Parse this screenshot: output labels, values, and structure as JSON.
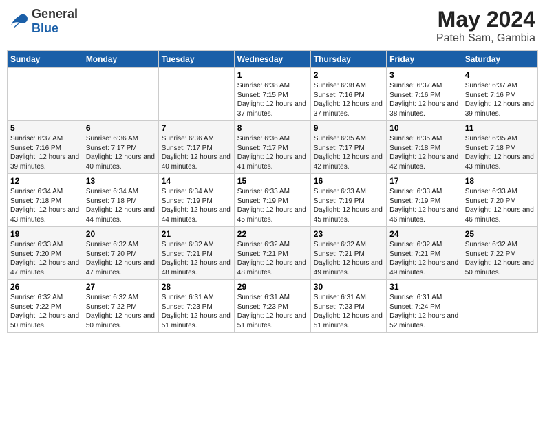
{
  "header": {
    "logo_general": "General",
    "logo_blue": "Blue",
    "month_year": "May 2024",
    "location": "Pateh Sam, Gambia"
  },
  "days_of_week": [
    "Sunday",
    "Monday",
    "Tuesday",
    "Wednesday",
    "Thursday",
    "Friday",
    "Saturday"
  ],
  "weeks": [
    [
      {
        "day": "",
        "sunrise": "",
        "sunset": "",
        "daylight": ""
      },
      {
        "day": "",
        "sunrise": "",
        "sunset": "",
        "daylight": ""
      },
      {
        "day": "",
        "sunrise": "",
        "sunset": "",
        "daylight": ""
      },
      {
        "day": "1",
        "sunrise": "Sunrise: 6:38 AM",
        "sunset": "Sunset: 7:15 PM",
        "daylight": "Daylight: 12 hours and 37 minutes."
      },
      {
        "day": "2",
        "sunrise": "Sunrise: 6:38 AM",
        "sunset": "Sunset: 7:16 PM",
        "daylight": "Daylight: 12 hours and 37 minutes."
      },
      {
        "day": "3",
        "sunrise": "Sunrise: 6:37 AM",
        "sunset": "Sunset: 7:16 PM",
        "daylight": "Daylight: 12 hours and 38 minutes."
      },
      {
        "day": "4",
        "sunrise": "Sunrise: 6:37 AM",
        "sunset": "Sunset: 7:16 PM",
        "daylight": "Daylight: 12 hours and 39 minutes."
      }
    ],
    [
      {
        "day": "5",
        "sunrise": "Sunrise: 6:37 AM",
        "sunset": "Sunset: 7:16 PM",
        "daylight": "Daylight: 12 hours and 39 minutes."
      },
      {
        "day": "6",
        "sunrise": "Sunrise: 6:36 AM",
        "sunset": "Sunset: 7:17 PM",
        "daylight": "Daylight: 12 hours and 40 minutes."
      },
      {
        "day": "7",
        "sunrise": "Sunrise: 6:36 AM",
        "sunset": "Sunset: 7:17 PM",
        "daylight": "Daylight: 12 hours and 40 minutes."
      },
      {
        "day": "8",
        "sunrise": "Sunrise: 6:36 AM",
        "sunset": "Sunset: 7:17 PM",
        "daylight": "Daylight: 12 hours and 41 minutes."
      },
      {
        "day": "9",
        "sunrise": "Sunrise: 6:35 AM",
        "sunset": "Sunset: 7:17 PM",
        "daylight": "Daylight: 12 hours and 42 minutes."
      },
      {
        "day": "10",
        "sunrise": "Sunrise: 6:35 AM",
        "sunset": "Sunset: 7:18 PM",
        "daylight": "Daylight: 12 hours and 42 minutes."
      },
      {
        "day": "11",
        "sunrise": "Sunrise: 6:35 AM",
        "sunset": "Sunset: 7:18 PM",
        "daylight": "Daylight: 12 hours and 43 minutes."
      }
    ],
    [
      {
        "day": "12",
        "sunrise": "Sunrise: 6:34 AM",
        "sunset": "Sunset: 7:18 PM",
        "daylight": "Daylight: 12 hours and 43 minutes."
      },
      {
        "day": "13",
        "sunrise": "Sunrise: 6:34 AM",
        "sunset": "Sunset: 7:18 PM",
        "daylight": "Daylight: 12 hours and 44 minutes."
      },
      {
        "day": "14",
        "sunrise": "Sunrise: 6:34 AM",
        "sunset": "Sunset: 7:19 PM",
        "daylight": "Daylight: 12 hours and 44 minutes."
      },
      {
        "day": "15",
        "sunrise": "Sunrise: 6:33 AM",
        "sunset": "Sunset: 7:19 PM",
        "daylight": "Daylight: 12 hours and 45 minutes."
      },
      {
        "day": "16",
        "sunrise": "Sunrise: 6:33 AM",
        "sunset": "Sunset: 7:19 PM",
        "daylight": "Daylight: 12 hours and 45 minutes."
      },
      {
        "day": "17",
        "sunrise": "Sunrise: 6:33 AM",
        "sunset": "Sunset: 7:19 PM",
        "daylight": "Daylight: 12 hours and 46 minutes."
      },
      {
        "day": "18",
        "sunrise": "Sunrise: 6:33 AM",
        "sunset": "Sunset: 7:20 PM",
        "daylight": "Daylight: 12 hours and 46 minutes."
      }
    ],
    [
      {
        "day": "19",
        "sunrise": "Sunrise: 6:33 AM",
        "sunset": "Sunset: 7:20 PM",
        "daylight": "Daylight: 12 hours and 47 minutes."
      },
      {
        "day": "20",
        "sunrise": "Sunrise: 6:32 AM",
        "sunset": "Sunset: 7:20 PM",
        "daylight": "Daylight: 12 hours and 47 minutes."
      },
      {
        "day": "21",
        "sunrise": "Sunrise: 6:32 AM",
        "sunset": "Sunset: 7:21 PM",
        "daylight": "Daylight: 12 hours and 48 minutes."
      },
      {
        "day": "22",
        "sunrise": "Sunrise: 6:32 AM",
        "sunset": "Sunset: 7:21 PM",
        "daylight": "Daylight: 12 hours and 48 minutes."
      },
      {
        "day": "23",
        "sunrise": "Sunrise: 6:32 AM",
        "sunset": "Sunset: 7:21 PM",
        "daylight": "Daylight: 12 hours and 49 minutes."
      },
      {
        "day": "24",
        "sunrise": "Sunrise: 6:32 AM",
        "sunset": "Sunset: 7:21 PM",
        "daylight": "Daylight: 12 hours and 49 minutes."
      },
      {
        "day": "25",
        "sunrise": "Sunrise: 6:32 AM",
        "sunset": "Sunset: 7:22 PM",
        "daylight": "Daylight: 12 hours and 50 minutes."
      }
    ],
    [
      {
        "day": "26",
        "sunrise": "Sunrise: 6:32 AM",
        "sunset": "Sunset: 7:22 PM",
        "daylight": "Daylight: 12 hours and 50 minutes."
      },
      {
        "day": "27",
        "sunrise": "Sunrise: 6:32 AM",
        "sunset": "Sunset: 7:22 PM",
        "daylight": "Daylight: 12 hours and 50 minutes."
      },
      {
        "day": "28",
        "sunrise": "Sunrise: 6:31 AM",
        "sunset": "Sunset: 7:23 PM",
        "daylight": "Daylight: 12 hours and 51 minutes."
      },
      {
        "day": "29",
        "sunrise": "Sunrise: 6:31 AM",
        "sunset": "Sunset: 7:23 PM",
        "daylight": "Daylight: 12 hours and 51 minutes."
      },
      {
        "day": "30",
        "sunrise": "Sunrise: 6:31 AM",
        "sunset": "Sunset: 7:23 PM",
        "daylight": "Daylight: 12 hours and 51 minutes."
      },
      {
        "day": "31",
        "sunrise": "Sunrise: 6:31 AM",
        "sunset": "Sunset: 7:24 PM",
        "daylight": "Daylight: 12 hours and 52 minutes."
      },
      {
        "day": "",
        "sunrise": "",
        "sunset": "",
        "daylight": ""
      }
    ]
  ]
}
